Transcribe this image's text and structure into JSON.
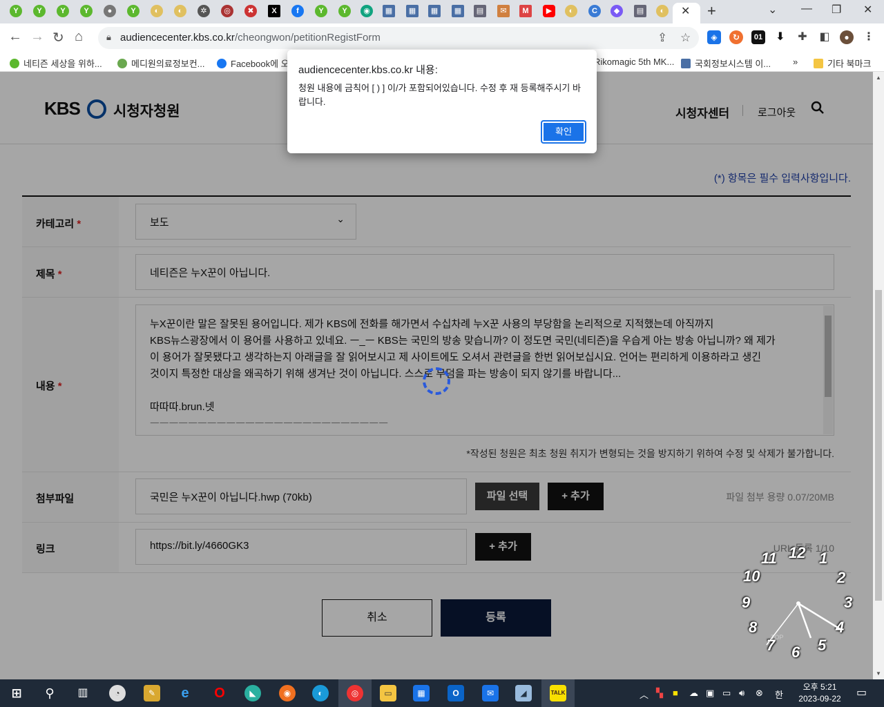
{
  "browser": {
    "url_host": "audiencecenter.kbs.co.kr",
    "url_path": "/cheongwon/petitionRegistForm",
    "tab_close": "✕",
    "new_tab": "+",
    "bookmarks": [
      {
        "label": "네티즌 세상을 위하...",
        "color": "#5cb82e"
      },
      {
        "label": "메디원의료정보컨...",
        "color": "#6aa84f"
      },
      {
        "label": "Facebook에 오",
        "color": "#1877f2"
      },
      {
        "label": "Rikomagic 5th MK...",
        "color": "#888888"
      },
      {
        "label": "국회정보시스템 이...",
        "color": "#4a6fa5"
      }
    ],
    "more_bookmarks": "»",
    "other_bookmarks": "기타 북마크",
    "ext_label": "01"
  },
  "header": {
    "logo": "KBS",
    "site_name": "시청자청원",
    "nav_center": "시청자센터",
    "nav_logout": "로그아웃"
  },
  "form": {
    "required_note": "(*) 항목은 필수 입력사항입니다.",
    "required_mark": "*",
    "category_label": "카테고리",
    "category_value": "보도",
    "title_label": "제목",
    "title_value": "네티즌은 누X꾼이 아닙니다.",
    "content_label": "내용",
    "content_lines": [
      "누X꾼이란 말은 잘못된 용어입니다. 제가 KBS에 전화를 해가면서 수십차례 누X꾼 사용의 부당함을 논리적으로 지적했는데 아직까지",
      "KBS뉴스광장에서 이 용어를 사용하고 있네요. ㅡ_ㅡ KBS는 국민의 방송 맞습니까? 이 정도면 국민(네티즌)을 우습게 아는 방송 아닙니까? 왜 제가",
      "이 용어가 잘못됐다고 생각하는지 아래글을 잘 읽어보시고 제 사이트에도 오셔서 관련글을 한번 읽어보십시요. 언어는 편리하게 이용하라고 생긴",
      "것이지 특정한 대상을 왜곡하기 위해 생겨난 것이 아닙니다. 스스로 무덤을 파는 방송이 되지 않기를 바랍니다...",
      "",
      "따따따.brun.넷",
      "ㅡㅡㅡㅡㅡㅡㅡㅡㅡㅡㅡㅡㅡㅡㅡㅡㅡㅡㅡㅡㅡㅡㅡㅡㅡ"
    ],
    "content_note": "*작성된 청원은 최초 청원 취지가 변형되는 것을 방지하기 위하여 수정 및 삭제가 불가합니다.",
    "attach_label": "첨부파일",
    "attach_value": "국민은 누X꾼이 아닙니다.hwp (70kb)",
    "file_select": "파일 선택",
    "add": "+ 추가",
    "file_capacity": "파일 첨부 용량 0.07/20MB",
    "link_label": "링크",
    "link_value": "https://bit.ly/4660GK3",
    "url_count": "URL 등록 1/10",
    "cancel": "취소",
    "submit": "등록"
  },
  "dialog": {
    "title": "audiencecenter.kbs.co.kr 내용:",
    "message": "청원 내용에 금칙어 [ ) ] 이/가 포함되어있습니다. 수정 후 재 등록해주시기 바랍니다.",
    "ok": "확인"
  },
  "clock": {
    "numbers": [
      "12",
      "1",
      "2",
      "3",
      "4",
      "5",
      "6",
      "7",
      "8",
      "9",
      "10",
      "11"
    ],
    "top_label": "TOP"
  },
  "taskbar": {
    "ime": "한",
    "time_period": "오후 5:21",
    "date": "2023-09-22",
    "talk": "TALK"
  }
}
